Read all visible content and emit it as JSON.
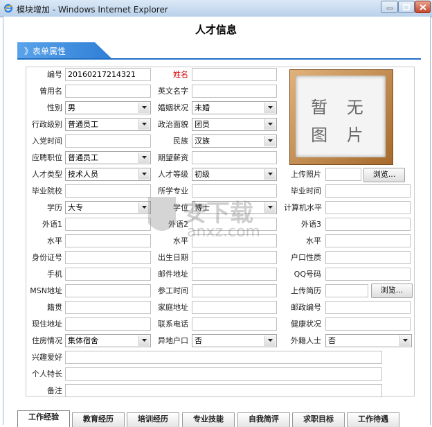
{
  "window": {
    "title": "模块增加 - Windows Internet Explorer"
  },
  "page": {
    "title": "人才信息",
    "section_label": "》表单属性"
  },
  "photo": {
    "line1": "暂 无",
    "line2": "图 片"
  },
  "watermark": {
    "text_cn": "安下载",
    "text_en": "anxz.com"
  },
  "form": {
    "labels": {
      "id": "编号",
      "name": "姓名",
      "former_name": "曾用名",
      "english_name": "英文名字",
      "gender": "性别",
      "marital": "婚姻状况",
      "admin_level": "行政级别",
      "political": "政治面貌",
      "party_date": "入党时间",
      "ethnic": "民族",
      "applied_post": "应聘职位",
      "expected_salary": "期望薪资",
      "talent_type": "人才类型",
      "talent_level": "人才等级",
      "upload_photo": "上传照片",
      "school": "毕业院校",
      "major": "所学专业",
      "grad_date": "毕业时间",
      "education": "学历",
      "degree": "学位",
      "computer_level": "计算机水平",
      "lang1": "外语1",
      "lang2": "外语2",
      "lang3": "外语3",
      "level1": "水平",
      "level2": "水平",
      "level3": "水平",
      "id_card": "身份证号",
      "birth_date": "出生日期",
      "hukou_type": "户口性质",
      "mobile": "手机",
      "email": "邮件地址",
      "qq": "QQ号码",
      "msn": "MSN地址",
      "work_start": "参工时间",
      "upload_resume": "上传简历",
      "native_place": "籍贯",
      "home_address": "家庭地址",
      "postcode": "邮政编号",
      "current_address": "现住地址",
      "phone": "联系电话",
      "health": "健康状况",
      "housing": "住房情况",
      "nonlocal_hukou": "异地户口",
      "foreigner": "外籍人士",
      "hobbies": "兴趣爱好",
      "specialty": "个人特长",
      "remarks": "备注"
    },
    "values": {
      "id": "20160217214321",
      "gender": "男",
      "marital": "未婚",
      "admin_level": "普通员工",
      "political": "团员",
      "ethnic": "汉族",
      "applied_post": "普通员工",
      "talent_type": "技术人员",
      "talent_level": "初级",
      "education": "大专",
      "degree": "博士",
      "housing": "集体宿舍",
      "nonlocal_hukou": "否",
      "foreigner": "否"
    },
    "browse_label": "浏览..."
  },
  "tabs": [
    "工作经验",
    "教育经历",
    "培训经历",
    "专业技能",
    "自我简评",
    "求职目标",
    "工作待遇"
  ],
  "colors": {
    "accent": "#1f6fc6",
    "required_label": "#d40000"
  }
}
